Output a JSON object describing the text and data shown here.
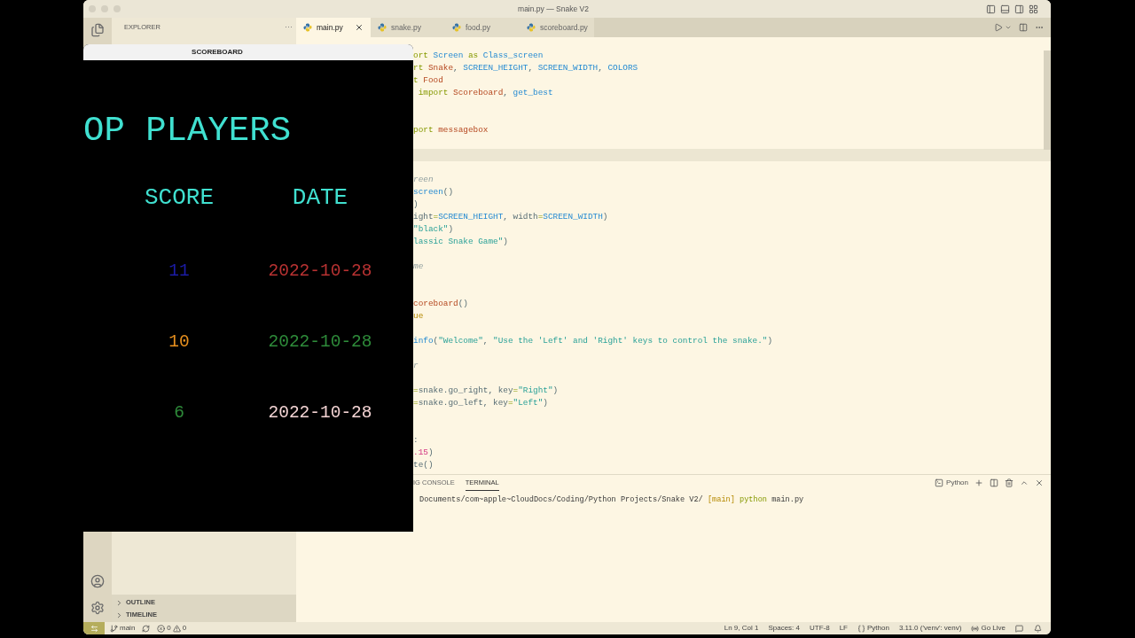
{
  "window": {
    "title": "main.py — Snake V2"
  },
  "sidebar": {
    "title": "EXPLORER",
    "more": "···",
    "sections": [
      {
        "label": "OUTLINE",
        "expanded": false
      },
      {
        "label": "TIMELINE",
        "expanded": false
      }
    ]
  },
  "tabs": [
    {
      "label": "main.py",
      "selected": true
    },
    {
      "label": "snake.py",
      "selected": false
    },
    {
      "label": "food.py",
      "selected": false
    },
    {
      "label": "scoreboard.py",
      "selected": false
    }
  ],
  "code_lines": [
    {
      "kind": "code",
      "tokens": [
        {
          "kind": "keyword",
          "text": "ort "
        },
        {
          "kind": "name",
          "text": "Screen"
        },
        {
          "kind": "keyword",
          "text": " as "
        },
        {
          "kind": "name",
          "text": "Class_screen"
        }
      ]
    },
    {
      "kind": "code",
      "tokens": [
        {
          "kind": "keyword",
          "text": "rt "
        },
        {
          "kind": "class",
          "text": "Snake"
        },
        {
          "kind": "plain",
          "text": ", "
        },
        {
          "kind": "name",
          "text": "SCREEN_HEIGHT"
        },
        {
          "kind": "plain",
          "text": ", "
        },
        {
          "kind": "name",
          "text": "SCREEN_WIDTH"
        },
        {
          "kind": "plain",
          "text": ", "
        },
        {
          "kind": "name",
          "text": "COLORS"
        }
      ]
    },
    {
      "kind": "code",
      "tokens": [
        {
          "kind": "keyword",
          "text": "t "
        },
        {
          "kind": "class",
          "text": "Food"
        }
      ]
    },
    {
      "kind": "code",
      "tokens": [
        {
          "kind": "keyword",
          "text": " import "
        },
        {
          "kind": "class",
          "text": "Scoreboard"
        },
        {
          "kind": "plain",
          "text": ", "
        },
        {
          "kind": "name",
          "text": "get_best"
        }
      ]
    },
    {
      "kind": "blank"
    },
    {
      "kind": "blank"
    },
    {
      "kind": "code",
      "tokens": [
        {
          "kind": "keyword",
          "text": "port "
        },
        {
          "kind": "class",
          "text": "messagebox"
        }
      ]
    },
    {
      "kind": "blank"
    },
    {
      "kind": "current"
    },
    {
      "kind": "blank"
    },
    {
      "kind": "code",
      "tokens": [
        {
          "kind": "comment",
          "text": "reen"
        }
      ]
    },
    {
      "kind": "code",
      "tokens": [
        {
          "kind": "name",
          "text": "screen"
        },
        {
          "kind": "plain",
          "text": "()"
        }
      ]
    },
    {
      "kind": "code",
      "tokens": [
        {
          "kind": "plain",
          "text": ")"
        }
      ]
    },
    {
      "kind": "code",
      "tokens": [
        {
          "kind": "plain",
          "text": "ight"
        },
        {
          "kind": "keyword",
          "text": "="
        },
        {
          "kind": "name",
          "text": "SCREEN_HEIGHT"
        },
        {
          "kind": "plain",
          "text": ", width"
        },
        {
          "kind": "keyword",
          "text": "="
        },
        {
          "kind": "name",
          "text": "SCREEN_WIDTH"
        },
        {
          "kind": "plain",
          "text": ")"
        }
      ]
    },
    {
      "kind": "code",
      "tokens": [
        {
          "kind": "string",
          "text": "\"black\""
        },
        {
          "kind": "plain",
          "text": ")"
        }
      ]
    },
    {
      "kind": "code",
      "tokens": [
        {
          "kind": "string",
          "text": "lassic Snake Game\""
        },
        {
          "kind": "plain",
          "text": ")"
        }
      ]
    },
    {
      "kind": "blank"
    },
    {
      "kind": "code",
      "tokens": [
        {
          "kind": "comment",
          "text": "me"
        }
      ]
    },
    {
      "kind": "blank"
    },
    {
      "kind": "blank"
    },
    {
      "kind": "code",
      "tokens": [
        {
          "kind": "class",
          "text": "coreboard"
        },
        {
          "kind": "plain",
          "text": "()"
        }
      ]
    },
    {
      "kind": "code",
      "tokens": [
        {
          "kind": "constant",
          "text": "ue"
        }
      ]
    },
    {
      "kind": "blank"
    },
    {
      "kind": "code",
      "tokens": [
        {
          "kind": "name",
          "text": "info"
        },
        {
          "kind": "plain",
          "text": "("
        },
        {
          "kind": "string",
          "text": "\"Welcome\""
        },
        {
          "kind": "plain",
          "text": ", "
        },
        {
          "kind": "string",
          "text": "\"Use the 'Left' and 'Right' keys to control the snake.\""
        },
        {
          "kind": "plain",
          "text": ")"
        }
      ]
    },
    {
      "kind": "blank"
    },
    {
      "kind": "code",
      "tokens": [
        {
          "kind": "comment",
          "text": "r"
        }
      ]
    },
    {
      "kind": "blank"
    },
    {
      "kind": "code",
      "tokens": [
        {
          "kind": "keyword",
          "text": "="
        },
        {
          "kind": "plain",
          "text": "snake.go_right, key"
        },
        {
          "kind": "keyword",
          "text": "="
        },
        {
          "kind": "string",
          "text": "\"Right\""
        },
        {
          "kind": "plain",
          "text": ")"
        }
      ]
    },
    {
      "kind": "code",
      "tokens": [
        {
          "kind": "keyword",
          "text": "="
        },
        {
          "kind": "plain",
          "text": "snake.go_left, key"
        },
        {
          "kind": "keyword",
          "text": "="
        },
        {
          "kind": "string",
          "text": "\"Left\""
        },
        {
          "kind": "plain",
          "text": ")"
        }
      ]
    },
    {
      "kind": "blank"
    },
    {
      "kind": "blank"
    },
    {
      "kind": "code",
      "tokens": [
        {
          "kind": "plain",
          "text": ":"
        }
      ]
    },
    {
      "kind": "code",
      "tokens": [
        {
          "kind": "number",
          "text": ".15"
        },
        {
          "kind": "plain",
          "text": ")"
        }
      ]
    },
    {
      "kind": "code",
      "tokens": [
        {
          "kind": "plain",
          "text": "te()"
        }
      ]
    }
  ],
  "panel": {
    "tabs": [
      {
        "label": "IG CONSOLE",
        "selected": false
      },
      {
        "label": "TERMINAL",
        "selected": true
      }
    ],
    "terminal_profile": "Python",
    "terminal_line": [
      {
        "kind": "plain",
        "text": "Documents/com~apple~CloudDocs/Coding/Python Projects/Snake V2/ "
      },
      {
        "kind": "branch",
        "text": "[main]"
      },
      {
        "kind": "command",
        "text": " python "
      },
      {
        "kind": "plain",
        "text": "main.py"
      }
    ]
  },
  "scoreboard_window": {
    "title": "SCOREBOARD",
    "heading": "OP PLAYERS",
    "columns": [
      "SCORE",
      "DATE"
    ],
    "rows": [
      {
        "score": {
          "text": "11",
          "color": "#1c1ca8"
        },
        "date": {
          "text": "2022-10-28",
          "color": "#b83232"
        }
      },
      {
        "score": {
          "text": "10",
          "color": "#e8901e"
        },
        "date": {
          "text": "2022-10-28",
          "color": "#2e8b3a"
        }
      },
      {
        "score": {
          "text": "6",
          "color": "#2e8b3a"
        },
        "date": {
          "text": "2022-10-28",
          "color": "#f4d4d4"
        }
      }
    ]
  },
  "status_bar": {
    "branch": "main",
    "errors": "0",
    "warnings": "0",
    "right": [
      {
        "kind": "text",
        "text": "Ln 9, Col 1"
      },
      {
        "kind": "text",
        "text": "Spaces: 4"
      },
      {
        "kind": "text",
        "text": "UTF-8"
      },
      {
        "kind": "text",
        "text": "LF"
      },
      {
        "kind": "language",
        "text": "Python"
      },
      {
        "kind": "text",
        "text": "3.11.0 ('venv': venv)"
      },
      {
        "kind": "live",
        "text": "Go Live"
      }
    ]
  }
}
